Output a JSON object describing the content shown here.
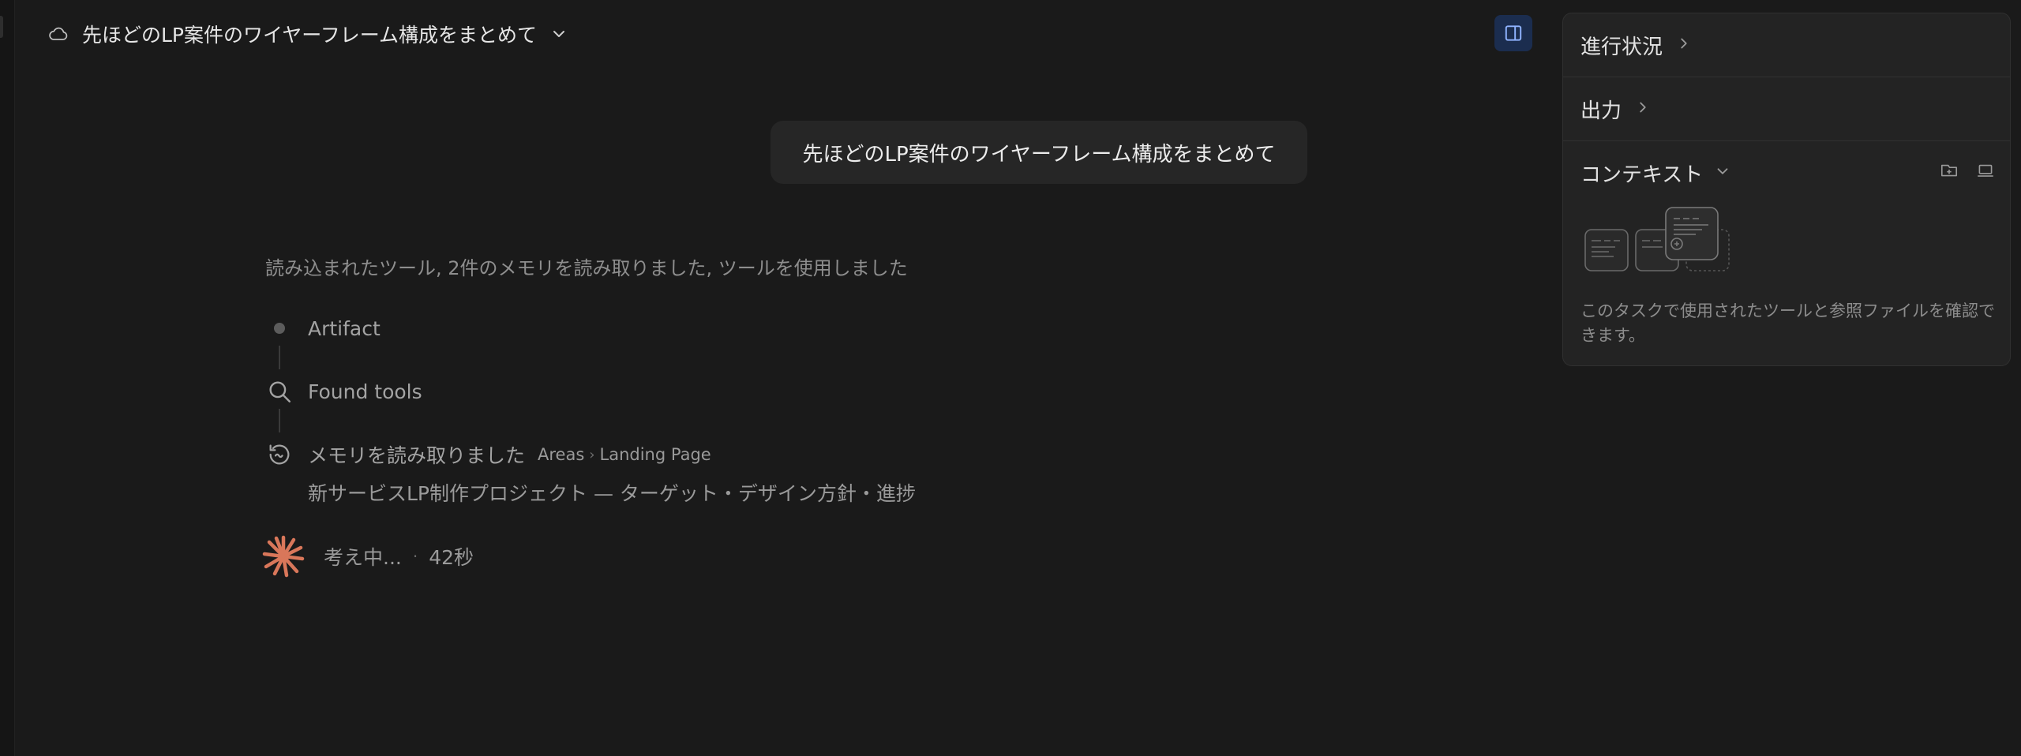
{
  "header": {
    "title": "先ほどのLP案件のワイヤーフレーム構成をまとめて",
    "cloud_icon": "cloud-icon",
    "dropdown_icon": "chevron-down-icon",
    "panel_toggle_icon": "sidebar-panel-icon"
  },
  "conversation": {
    "user_message": "先ほどのLP案件のワイヤーフレーム構成をまとめて",
    "activity_summary": "読み込まれたツール, 2件のメモリを読み取りました, ツールを使用しました",
    "steps": [
      {
        "label": "Artifact",
        "icon": "dot-icon"
      },
      {
        "label": "Found tools",
        "icon": "search-icon"
      },
      {
        "label": "メモリを読み取りました",
        "icon": "memory-history-icon",
        "breadcrumb": [
          "Areas",
          "Landing Page"
        ],
        "detail": "新サービスLP制作プロジェクト — ターゲット・デザイン方針・進捗"
      }
    ],
    "thinking": {
      "label": "考え中...",
      "separator": "·",
      "elapsed": "42秒",
      "icon": "thinking-spinner-icon"
    }
  },
  "side_panel": {
    "progress_label": "進行状況",
    "output_label": "出力",
    "context_label": "コンテキスト",
    "context_description": "このタスクで使用されたツールと参照ファイルを確認できます。",
    "context_actions": [
      "folder-add-icon",
      "laptop-icon"
    ]
  },
  "colors": {
    "background": "#1a1a1a",
    "panel_background": "#232323",
    "accent_blue": "#1b2d4f",
    "thinking_orange": "#d9775a"
  }
}
